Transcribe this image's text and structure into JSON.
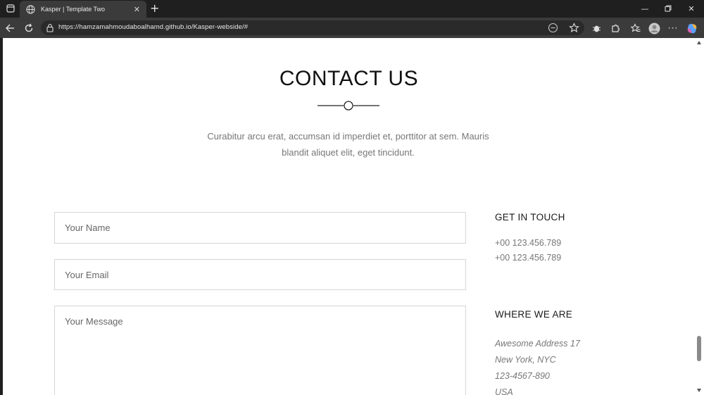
{
  "browser": {
    "tab_title": "Kasper | Template Two",
    "url": "https://hamzamahmoudaboalhamd.github.io/Kasper-webside/#"
  },
  "icons": {
    "tab_actions": "tab-actions-icon",
    "globe": "globe-icon",
    "back": "back-arrow-icon",
    "refresh": "refresh-icon",
    "lock": "lock-icon",
    "read_aloud": "read-aloud-icon",
    "favorite": "star-icon",
    "extensions": "puzzle-icon",
    "favorites": "favorites-icon",
    "profile": "profile-icon",
    "more": "more-icon",
    "copilot": "copilot-icon"
  },
  "contact": {
    "title": "CONTACT US",
    "intro_line1": "Curabitur arcu erat, accumsan id imperdiet et, porttitor at sem. Mauris",
    "intro_line2": "blandit aliquet elit, eget tincidunt.",
    "form": {
      "name_placeholder": "Your Name",
      "email_placeholder": "Your Email",
      "message_placeholder": "Your Message"
    },
    "get_in_touch": {
      "heading": "GET IN TOUCH",
      "phones": [
        "+00 123.456.789",
        "+00 123.456.789"
      ]
    },
    "where_we_are": {
      "heading": "WHERE WE ARE",
      "lines": [
        "Awesome Address 17",
        "New York, NYC",
        "123-4567-890",
        "USA"
      ]
    }
  }
}
